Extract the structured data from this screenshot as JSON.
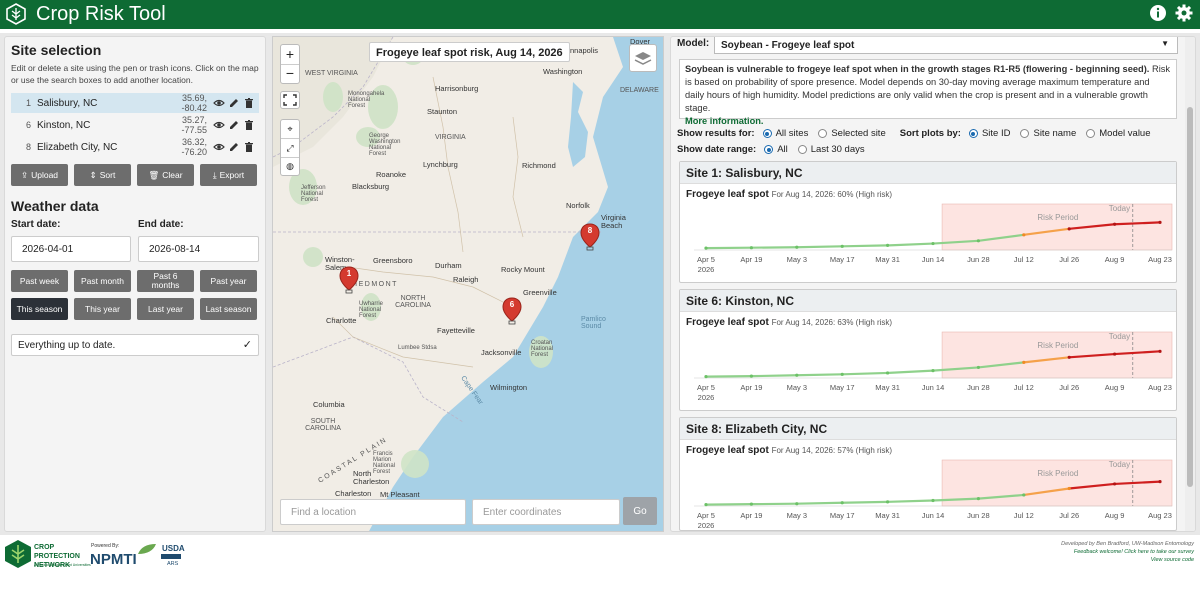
{
  "header": {
    "title": "Crop Risk Tool",
    "icons": [
      "logo-icon",
      "info-icon",
      "gear-icon"
    ]
  },
  "left": {
    "site_selection_title": "Site selection",
    "site_desc": "Edit or delete a site using the pen or trash icons. Click on the map or use the search boxes to add another location.",
    "sites": [
      {
        "id": "1",
        "name": "Salisbury, NC",
        "coords": "35.69, -80.42"
      },
      {
        "id": "6",
        "name": "Kinston, NC",
        "coords": "35.27, -77.55"
      },
      {
        "id": "8",
        "name": "Elizabeth City, NC",
        "coords": "36.32, -76.20"
      }
    ],
    "buttons": {
      "upload": "Upload",
      "sort": "Sort",
      "clear": "Clear",
      "export": "Export"
    },
    "weather_title": "Weather data",
    "start_label": "Start date:",
    "end_label": "End date:",
    "start_value": "2026-04-01",
    "end_value": "2026-08-14",
    "range_buttons": [
      "Past week",
      "Past month",
      "Past 6 months",
      "Past year",
      "This season",
      "This year",
      "Last year",
      "Last season"
    ],
    "status": "Everything up to date."
  },
  "map": {
    "title": "Frogeye leaf spot risk, Aug 14, 2026",
    "search_placeholder": "Find a location",
    "coords_placeholder": "Enter coordinates",
    "go": "Go",
    "zoom_in": "+",
    "zoom_out": "−",
    "labels": {
      "washington": "Washington",
      "annapolis": "Annapolis",
      "dover": "Dover",
      "delaware": "DELAWARE",
      "west_virginia": "WEST VIRGINIA",
      "harrisonburg": "Harrisonburg",
      "staunton": "Staunton",
      "monongahela": "Monongahela National Forest",
      "virginia": "VIRGINIA",
      "gw_forest": "George Washington National Forest",
      "lynchburg": "Lynchburg",
      "richmond": "Richmond",
      "roanoke": "Roanoke",
      "blacksburg": "Blacksburg",
      "jefferson": "Jefferson National Forest",
      "norfolk": "Norfolk",
      "virginia_beach": "Virginia Beach",
      "winston_salem": "Winston-Salem",
      "greensboro": "Greensboro",
      "durham": "Durham",
      "raleigh": "Raleigh",
      "rocky_mount": "Rocky Mount",
      "piedmont": "PIEDMONT",
      "north_carolina": "NORTH CAROLINA",
      "greenville": "Greenville",
      "uwharrie": "Uwharrie National Forest",
      "charlotte": "Charlotte",
      "fayetteville": "Fayetteville",
      "pamlico": "Pamlico Sound",
      "croatan": "Croatan National Forest",
      "lumbee": "Lumbee Stdsa",
      "jacksonville": "Jacksonville",
      "wilmington": "Wilmington",
      "columbia": "Columbia",
      "south_carolina": "SOUTH CAROLINA",
      "francis_marion": "Francis Marion National Forest",
      "north_charleston": "North Charleston",
      "charleston": "Charleston",
      "mt_pleasant": "Mt Pleasant",
      "coastal_plain": "COASTAL PLAIN",
      "cape_fear": "Cape Fear"
    },
    "pins": [
      {
        "label": "1",
        "color": "#d43a2f"
      },
      {
        "label": "6",
        "color": "#d43a2f"
      },
      {
        "label": "8",
        "color": "#d43a2f"
      }
    ]
  },
  "right": {
    "model_label": "Model:",
    "model_value": "Soybean - Frogeye leaf spot",
    "info_bold": "Soybean is vulnerable to frogeye leaf spot when in the growth stages R1-R5 (flowering - beginning seed).",
    "info_text": " Risk is based on probability of spore presence. Model depends on 30-day moving average maximum temperature and daily hours of high humidity. Model predictions are only valid when the crop is present and in a vulnerable growth stage.",
    "more_info": "More information.",
    "show_results_label": "Show results for:",
    "results_opts": [
      "All sites",
      "Selected site"
    ],
    "sort_label": "Sort plots by:",
    "sort_opts": [
      "Site ID",
      "Site name",
      "Model value"
    ],
    "date_range_label": "Show date range:",
    "date_opts": [
      "All",
      "Last 30 days"
    ],
    "cards": [
      {
        "title": "Site 1: Salisbury, NC",
        "sub_bold": "Frogeye leaf spot",
        "sub": "For Aug 14, 2026: 60% (High risk)"
      },
      {
        "title": "Site 6: Kinston, NC",
        "sub_bold": "Frogeye leaf spot",
        "sub": "For Aug 14, 2026: 63% (High risk)"
      },
      {
        "title": "Site 8: Elizabeth City, NC",
        "sub_bold": "Frogeye leaf spot",
        "sub": "For Aug 14, 2026: 57% (High risk)"
      }
    ]
  },
  "chart_data": [
    {
      "type": "line",
      "title": "Frogeye leaf spot",
      "x": [
        "Apr 5",
        "Apr 19",
        "May 3",
        "May 17",
        "May 31",
        "Jun 14",
        "Jun 28",
        "Jul 12",
        "Jul 26",
        "Aug 9",
        "Aug 23"
      ],
      "year": "2026",
      "annotations": [
        "Risk Period",
        "Today"
      ],
      "risk_values": [
        4,
        5,
        6,
        8,
        10,
        14,
        20,
        33,
        46,
        56,
        60
      ],
      "ylim": [
        0,
        100
      ]
    },
    {
      "type": "line",
      "title": "Frogeye leaf spot",
      "x": [
        "Apr 5",
        "Apr 19",
        "May 3",
        "May 17",
        "May 31",
        "Jun 14",
        "Jun 28",
        "Jul 12",
        "Jul 26",
        "Aug 9",
        "Aug 23"
      ],
      "year": "2026",
      "annotations": [
        "Risk Period",
        "Today"
      ],
      "risk_values": [
        3,
        4,
        6,
        8,
        11,
        16,
        23,
        34,
        45,
        52,
        58
      ],
      "ylim": [
        0,
        100
      ]
    },
    {
      "type": "line",
      "title": "Frogeye leaf spot",
      "x": [
        "Apr 5",
        "Apr 19",
        "May 3",
        "May 17",
        "May 31",
        "Jun 14",
        "Jun 28",
        "Jul 12",
        "Jul 26",
        "Aug 9",
        "Aug 23"
      ],
      "year": "2026",
      "annotations": [
        "Risk Period",
        "Today"
      ],
      "risk_values": [
        3,
        4,
        5,
        7,
        9,
        12,
        16,
        24,
        38,
        48,
        53
      ],
      "ylim": [
        0,
        100
      ]
    }
  ],
  "footer": {
    "cpn": "CROP PROTECTION NETWORK",
    "cpn_sub": "A Product of Land-Grant Universities",
    "powered": "Powered By:",
    "npmti": "NPMTI",
    "usda": "USDA",
    "ars": "ARS",
    "credit": "Developed by Ben Bradford, UW-Madison Entomology",
    "feedback": "Feedback welcome! Click here to take our survey",
    "source": "View source code"
  }
}
